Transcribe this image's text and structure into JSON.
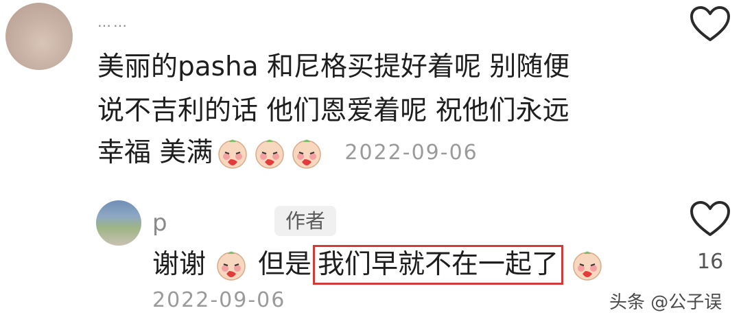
{
  "comments": [
    {
      "username": "……",
      "text_lines": [
        "美丽的pasha 和尼格买提好着呢 别随便",
        "说不吉利的话 他们恩爱着呢 祝他们永远",
        "幸福 美满"
      ],
      "emoji_count": 3,
      "date": "2022-09-06",
      "like_label": ""
    }
  ],
  "reply": {
    "username": "p",
    "author_badge": "作者",
    "text_prefix": "谢谢",
    "text_middle": "但是",
    "highlighted_text": "我们早就不在一起了",
    "date": "2022-09-06",
    "like_count": "16"
  },
  "icons": {
    "avatar": "avatar",
    "heart": "heart-outline-icon",
    "emoji": "shy-face-emoji"
  },
  "colors": {
    "highlight_border": "#d23a3a",
    "text": "#1e1e1e",
    "secondary": "#9a9a9a"
  },
  "watermark": "头条 @公子误"
}
